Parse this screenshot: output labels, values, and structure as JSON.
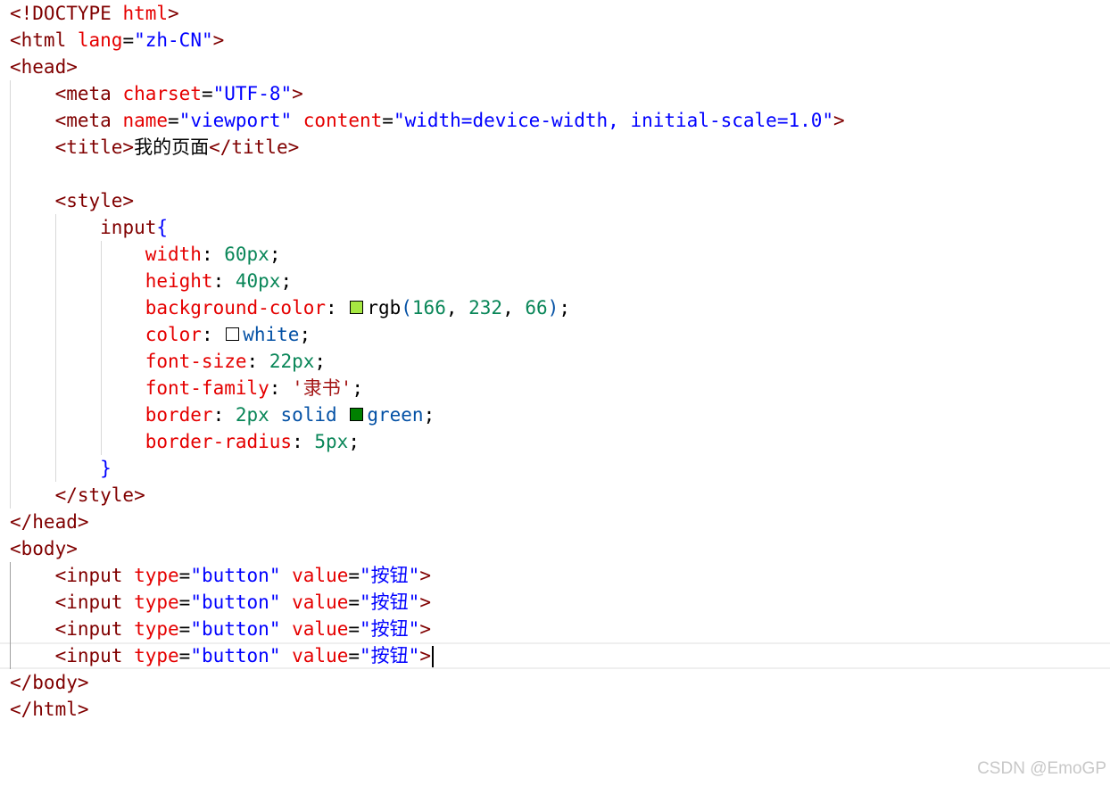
{
  "editor": {
    "lines": [
      {
        "indent": 0,
        "tokens": [
          [
            "<!DOCTYPE",
            "d"
          ],
          [
            " ",
            "p"
          ],
          [
            "html",
            "a"
          ],
          [
            ">",
            "d"
          ]
        ]
      },
      {
        "indent": 0,
        "tokens": [
          [
            "<html",
            "d"
          ],
          [
            " ",
            "p"
          ],
          [
            "lang",
            "a"
          ],
          [
            "=",
            "p"
          ],
          [
            "\"zh-CN\"",
            "v"
          ],
          [
            ">",
            "d"
          ]
        ]
      },
      {
        "indent": 0,
        "tokens": [
          [
            "<head>",
            "d"
          ]
        ]
      },
      {
        "indent": 1,
        "tokens": [
          [
            "<meta",
            "d"
          ],
          [
            " ",
            "p"
          ],
          [
            "charset",
            "a"
          ],
          [
            "=",
            "p"
          ],
          [
            "\"UTF-8\"",
            "v"
          ],
          [
            ">",
            "d"
          ]
        ]
      },
      {
        "indent": 1,
        "tokens": [
          [
            "<meta",
            "d"
          ],
          [
            " ",
            "p"
          ],
          [
            "name",
            "a"
          ],
          [
            "=",
            "p"
          ],
          [
            "\"viewport\"",
            "v"
          ],
          [
            " ",
            "p"
          ],
          [
            "content",
            "a"
          ],
          [
            "=",
            "p"
          ],
          [
            "\"width=device-width, initial-scale=1.0\"",
            "v"
          ],
          [
            ">",
            "d"
          ]
        ]
      },
      {
        "indent": 1,
        "tokens": [
          [
            "<title>",
            "d"
          ],
          [
            "我的页面",
            "p"
          ],
          [
            "</title>",
            "d"
          ]
        ]
      },
      {
        "indent": 0,
        "tokens": []
      },
      {
        "indent": 1,
        "tokens": [
          [
            "<style>",
            "d"
          ]
        ]
      },
      {
        "indent": 2,
        "tokens": [
          [
            "input",
            "d"
          ],
          [
            "{",
            "b"
          ]
        ]
      },
      {
        "indent": 3,
        "tokens": [
          [
            "width",
            "a"
          ],
          [
            ": ",
            "p"
          ],
          [
            "60px",
            "n"
          ],
          [
            ";",
            "p"
          ]
        ]
      },
      {
        "indent": 3,
        "tokens": [
          [
            "height",
            "a"
          ],
          [
            ": ",
            "p"
          ],
          [
            "40px",
            "n"
          ],
          [
            ";",
            "p"
          ]
        ]
      },
      {
        "indent": 3,
        "tokens": [
          [
            "background-color",
            "a"
          ],
          [
            ": ",
            "p"
          ],
          [
            "#a6e842",
            "swatch"
          ],
          [
            "rgb",
            "p"
          ],
          [
            "(",
            "k"
          ],
          [
            "166",
            "n"
          ],
          [
            ", ",
            "p"
          ],
          [
            "232",
            "n"
          ],
          [
            ", ",
            "p"
          ],
          [
            "66",
            "n"
          ],
          [
            ")",
            "k"
          ],
          [
            ";",
            "p"
          ]
        ]
      },
      {
        "indent": 3,
        "tokens": [
          [
            "color",
            "a"
          ],
          [
            ": ",
            "p"
          ],
          [
            "#ffffff",
            "swatch"
          ],
          [
            "white",
            "k"
          ],
          [
            ";",
            "p"
          ]
        ]
      },
      {
        "indent": 3,
        "tokens": [
          [
            "font-size",
            "a"
          ],
          [
            ": ",
            "p"
          ],
          [
            "22px",
            "n"
          ],
          [
            ";",
            "p"
          ]
        ]
      },
      {
        "indent": 3,
        "tokens": [
          [
            "font-family",
            "a"
          ],
          [
            ": ",
            "p"
          ],
          [
            "'隶书'",
            "s"
          ],
          [
            ";",
            "p"
          ]
        ]
      },
      {
        "indent": 3,
        "tokens": [
          [
            "border",
            "a"
          ],
          [
            ": ",
            "p"
          ],
          [
            "2px",
            "n"
          ],
          [
            " ",
            "p"
          ],
          [
            "solid",
            "k"
          ],
          [
            " ",
            "p"
          ],
          [
            "#008000",
            "swatch"
          ],
          [
            "green",
            "k"
          ],
          [
            ";",
            "p"
          ]
        ]
      },
      {
        "indent": 3,
        "tokens": [
          [
            "border-radius",
            "a"
          ],
          [
            ": ",
            "p"
          ],
          [
            "5px",
            "n"
          ],
          [
            ";",
            "p"
          ]
        ]
      },
      {
        "indent": 2,
        "tokens": [
          [
            "}",
            "b"
          ]
        ]
      },
      {
        "indent": 1,
        "tokens": [
          [
            "</style>",
            "d"
          ]
        ]
      },
      {
        "indent": 0,
        "tokens": [
          [
            "</head>",
            "d"
          ]
        ]
      },
      {
        "indent": 0,
        "tokens": [
          [
            "<body>",
            "d"
          ]
        ]
      },
      {
        "indent": 1,
        "tokens": [
          [
            "<input",
            "d"
          ],
          [
            " ",
            "p"
          ],
          [
            "type",
            "a"
          ],
          [
            "=",
            "p"
          ],
          [
            "\"button\"",
            "v"
          ],
          [
            " ",
            "p"
          ],
          [
            "value",
            "a"
          ],
          [
            "=",
            "p"
          ],
          [
            "\"按钮\"",
            "v"
          ],
          [
            ">",
            "d"
          ]
        ]
      },
      {
        "indent": 1,
        "tokens": [
          [
            "<input",
            "d"
          ],
          [
            " ",
            "p"
          ],
          [
            "type",
            "a"
          ],
          [
            "=",
            "p"
          ],
          [
            "\"button\"",
            "v"
          ],
          [
            " ",
            "p"
          ],
          [
            "value",
            "a"
          ],
          [
            "=",
            "p"
          ],
          [
            "\"按钮\"",
            "v"
          ],
          [
            ">",
            "d"
          ]
        ]
      },
      {
        "indent": 1,
        "tokens": [
          [
            "<input",
            "d"
          ],
          [
            " ",
            "p"
          ],
          [
            "type",
            "a"
          ],
          [
            "=",
            "p"
          ],
          [
            "\"button\"",
            "v"
          ],
          [
            " ",
            "p"
          ],
          [
            "value",
            "a"
          ],
          [
            "=",
            "p"
          ],
          [
            "\"按钮\"",
            "v"
          ],
          [
            ">",
            "d"
          ]
        ]
      },
      {
        "indent": 1,
        "current": true,
        "tokens": [
          [
            "<input",
            "d"
          ],
          [
            " ",
            "p"
          ],
          [
            "type",
            "a"
          ],
          [
            "=",
            "p"
          ],
          [
            "\"button\"",
            "v"
          ],
          [
            " ",
            "p"
          ],
          [
            "value",
            "a"
          ],
          [
            "=",
            "p"
          ],
          [
            "\"按钮\"",
            "v"
          ],
          [
            ">",
            "d"
          ]
        ]
      },
      {
        "indent": 0,
        "tokens": [
          [
            "</body>",
            "d"
          ]
        ]
      },
      {
        "indent": 0,
        "tokens": [
          [
            "</html>",
            "d"
          ]
        ]
      }
    ]
  },
  "watermark": "CSDN @EmoGP"
}
